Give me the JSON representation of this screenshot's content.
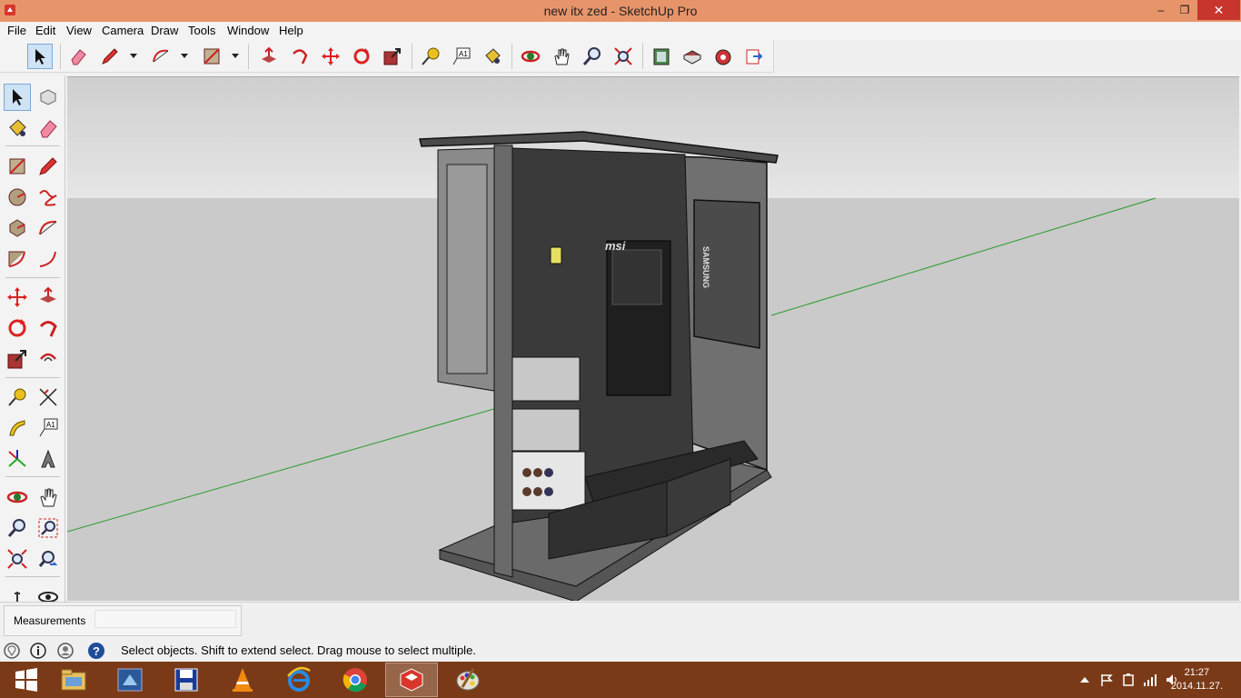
{
  "window": {
    "title": "new itx zed - SketchUp Pro",
    "minimize": "–",
    "maximize": "❐",
    "close": "✕"
  },
  "menu": [
    "File",
    "Edit",
    "View",
    "Camera",
    "Draw",
    "Tools",
    "Window",
    "Help"
  ],
  "viewport": {
    "model_text": {
      "brand": "msi",
      "drive": "SAMSUNG"
    },
    "colors": {
      "sky": "#e6e6e6",
      "ground": "#cacaca",
      "axis_green": "#2a9a2a"
    }
  },
  "measurements": {
    "label": "Measurements",
    "value": ""
  },
  "status": {
    "text": "Select objects. Shift to extend select. Drag mouse to select multiple."
  },
  "taskbar": {
    "clock_time": "21:27",
    "clock_date": "2014.11.27."
  },
  "toolbar_annotation": {
    "text_tool": "A1"
  },
  "left_annotation": {
    "text_tool": "A1"
  }
}
